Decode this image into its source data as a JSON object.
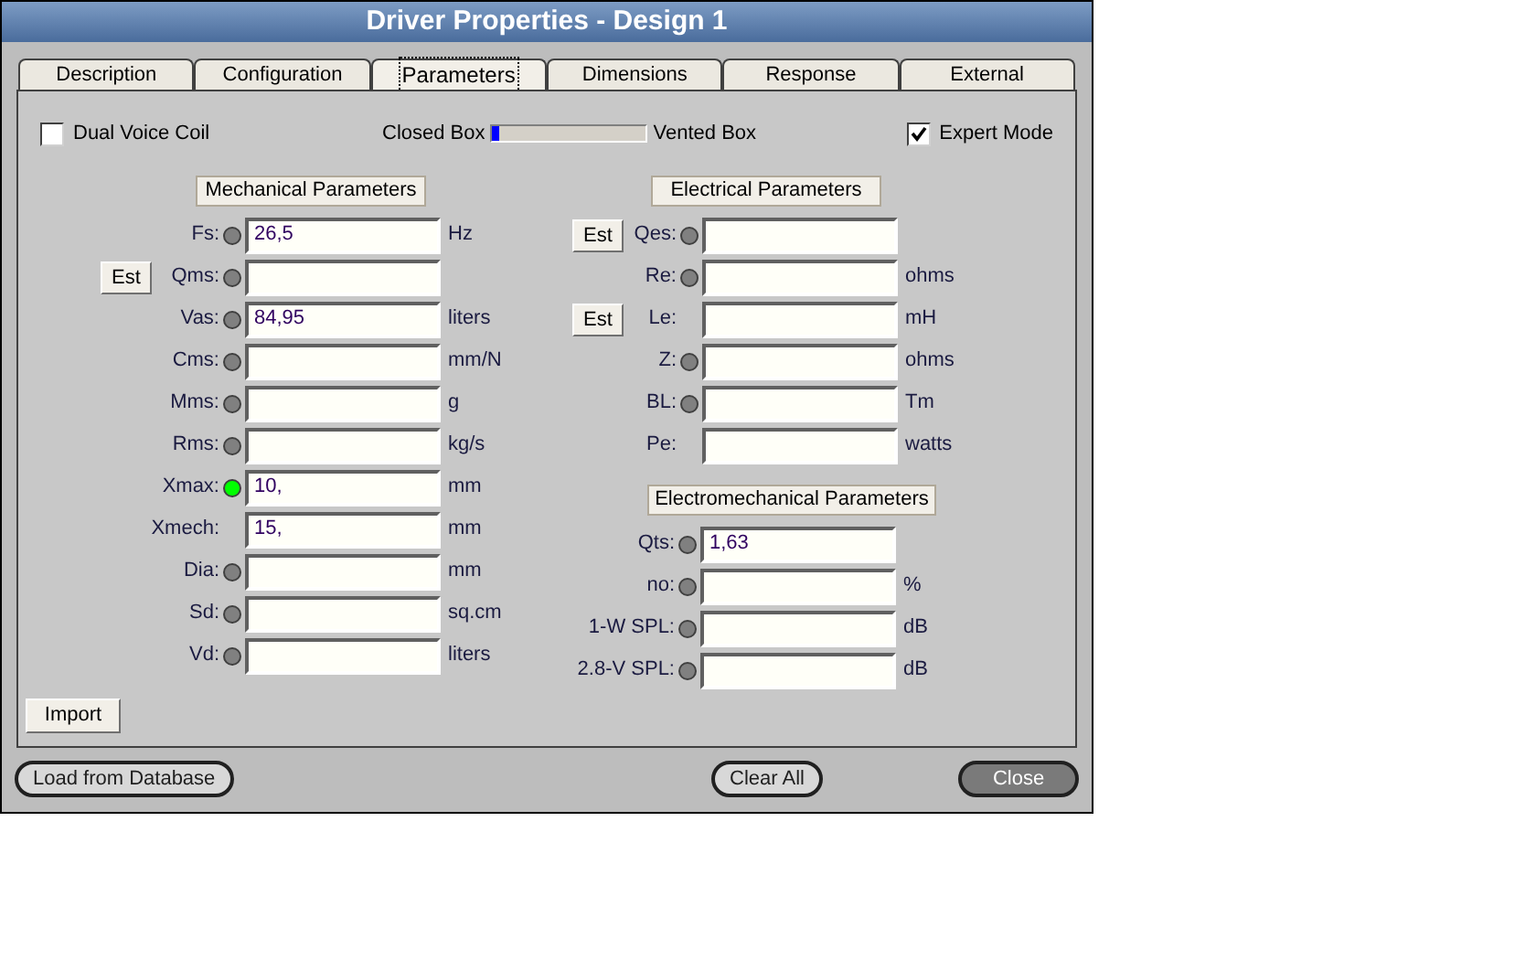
{
  "window": {
    "title": "Driver Properties - Design 1"
  },
  "tabs": [
    {
      "label": "Description",
      "selected": false
    },
    {
      "label": "Configuration",
      "selected": false
    },
    {
      "label": "Parameters",
      "selected": true
    },
    {
      "label": "Dimensions",
      "selected": false
    },
    {
      "label": "Response",
      "selected": false
    },
    {
      "label": "External",
      "selected": false
    }
  ],
  "dual_voice_coil": {
    "label": "Dual Voice Coil",
    "checked": false
  },
  "box_type": {
    "left_label": "Closed Box",
    "right_label": "Vented Box",
    "level": 0.05
  },
  "expert_mode": {
    "label": "Expert Mode",
    "checked": true
  },
  "mechanical": {
    "heading": "Mechanical Parameters",
    "rows": [
      {
        "label": "Fs:",
        "color": "#808080",
        "value": "26,5",
        "unit": "Hz",
        "est": false
      },
      {
        "label": "Qms:",
        "color": "#808080",
        "value": "",
        "unit": "",
        "est": true,
        "est_label": "Est"
      },
      {
        "label": "Vas:",
        "color": "#808080",
        "value": "84,95",
        "unit": "liters",
        "est": false
      },
      {
        "label": "Cms:",
        "color": "#808080",
        "value": "",
        "unit": "mm/N",
        "est": false
      },
      {
        "label": "Mms:",
        "color": "#808080",
        "value": "",
        "unit": "g",
        "est": false
      },
      {
        "label": "Rms:",
        "color": "#808080",
        "value": "",
        "unit": "kg/s",
        "est": false
      },
      {
        "label": "Xmax:",
        "color": "#00ff00",
        "value": "10,",
        "unit": "mm",
        "est": false
      },
      {
        "label": "Xmech:",
        "value": "15,",
        "unit": "mm",
        "est": false
      },
      {
        "label": "Dia:",
        "color": "#808080",
        "value": "",
        "unit": "mm",
        "est": false
      },
      {
        "label": "Sd:",
        "color": "#808080",
        "value": "",
        "unit": "sq.cm",
        "est": false
      },
      {
        "label": "Vd:",
        "color": "#808080",
        "value": "",
        "unit": "liters",
        "est": false
      }
    ]
  },
  "electrical": {
    "heading": "Electrical Parameters",
    "rows": [
      {
        "label": "Qes:",
        "color": "#808080",
        "value": "",
        "unit": "",
        "est": true,
        "est_label": "Est"
      },
      {
        "label": "Re:",
        "color": "#808080",
        "value": "",
        "unit": "ohms",
        "est": false
      },
      {
        "label": "Le:",
        "value": "",
        "unit": "mH",
        "est": true,
        "est_label": "Est"
      },
      {
        "label": "Z:",
        "color": "#808080",
        "value": "",
        "unit": "ohms",
        "est": false
      },
      {
        "label": "BL:",
        "color": "#808080",
        "value": "",
        "unit": "Tm",
        "est": false
      },
      {
        "label": "Pe:",
        "value": "",
        "unit": "watts",
        "est": false
      }
    ]
  },
  "electromechanical": {
    "heading": "Electromechanical Parameters",
    "rows": [
      {
        "label": "Qts:",
        "color": "#808080",
        "value": "1,63",
        "unit": "",
        "est": false
      },
      {
        "label": "no:",
        "color": "#808080",
        "value": "",
        "unit": "%",
        "est": false
      },
      {
        "label": "1-W SPL:",
        "color": "#808080",
        "value": "",
        "unit": "dB",
        "est": false
      },
      {
        "label": "2.8-V SPL:",
        "color": "#808080",
        "value": "",
        "unit": "dB",
        "est": false
      }
    ]
  },
  "import_button": "Import",
  "footer_buttons": [
    {
      "label": "Load from Database",
      "kind": "normal"
    },
    {
      "label": "Clear All",
      "kind": "normal"
    },
    {
      "label": "Close",
      "kind": "dark"
    }
  ]
}
